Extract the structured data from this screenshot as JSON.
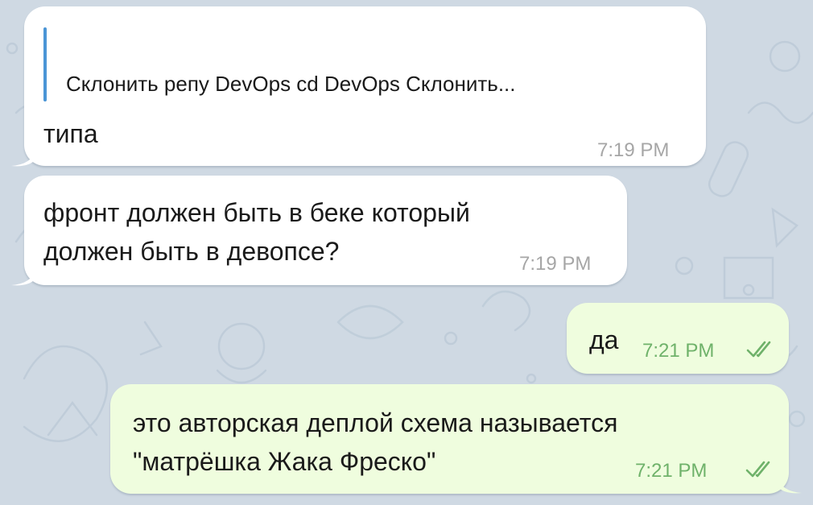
{
  "chat": {
    "messages": [
      {
        "direction": "incoming",
        "reply_preview": "Склонить репу DevOps cd DevOps Склонить...",
        "text": "типа",
        "time": "7:19 PM"
      },
      {
        "direction": "incoming",
        "text": "фронт должен быть в беке который\nдолжен быть в девопсе?",
        "time": "7:19 PM"
      },
      {
        "direction": "outgoing",
        "text": "да",
        "time": "7:21 PM",
        "status_icon": "double-check-icon"
      },
      {
        "direction": "outgoing",
        "text": "это авторская деплой схема называется\n\"матрёшка Жака Фреско\"",
        "time": "7:21 PM",
        "status_icon": "double-check-icon"
      }
    ]
  },
  "colors": {
    "background": "#cfd9e3",
    "incoming_bubble": "#ffffff",
    "outgoing_bubble": "#effdde",
    "reply_accent": "#4a95d6",
    "outgoing_meta": "#6fb26a"
  }
}
